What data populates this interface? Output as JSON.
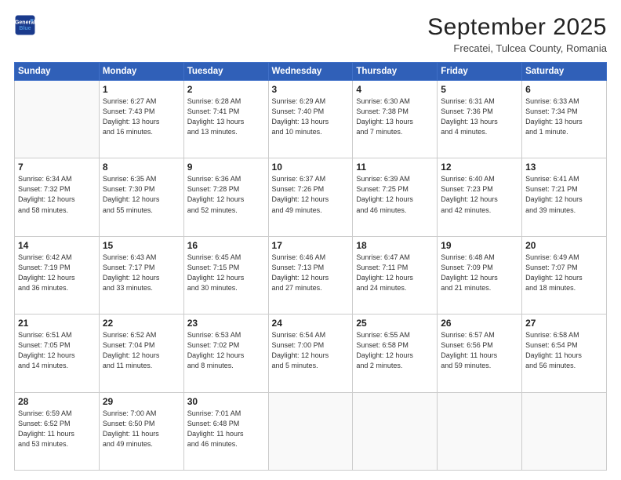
{
  "header": {
    "logo": {
      "line1": "General",
      "line2": "Blue"
    },
    "title": "September 2025",
    "subtitle": "Frecatei, Tulcea County, Romania"
  },
  "days_of_week": [
    "Sunday",
    "Monday",
    "Tuesday",
    "Wednesday",
    "Thursday",
    "Friday",
    "Saturday"
  ],
  "weeks": [
    [
      {
        "day": "",
        "info": ""
      },
      {
        "day": "1",
        "info": "Sunrise: 6:27 AM\nSunset: 7:43 PM\nDaylight: 13 hours\nand 16 minutes."
      },
      {
        "day": "2",
        "info": "Sunrise: 6:28 AM\nSunset: 7:41 PM\nDaylight: 13 hours\nand 13 minutes."
      },
      {
        "day": "3",
        "info": "Sunrise: 6:29 AM\nSunset: 7:40 PM\nDaylight: 13 hours\nand 10 minutes."
      },
      {
        "day": "4",
        "info": "Sunrise: 6:30 AM\nSunset: 7:38 PM\nDaylight: 13 hours\nand 7 minutes."
      },
      {
        "day": "5",
        "info": "Sunrise: 6:31 AM\nSunset: 7:36 PM\nDaylight: 13 hours\nand 4 minutes."
      },
      {
        "day": "6",
        "info": "Sunrise: 6:33 AM\nSunset: 7:34 PM\nDaylight: 13 hours\nand 1 minute."
      }
    ],
    [
      {
        "day": "7",
        "info": "Sunrise: 6:34 AM\nSunset: 7:32 PM\nDaylight: 12 hours\nand 58 minutes."
      },
      {
        "day": "8",
        "info": "Sunrise: 6:35 AM\nSunset: 7:30 PM\nDaylight: 12 hours\nand 55 minutes."
      },
      {
        "day": "9",
        "info": "Sunrise: 6:36 AM\nSunset: 7:28 PM\nDaylight: 12 hours\nand 52 minutes."
      },
      {
        "day": "10",
        "info": "Sunrise: 6:37 AM\nSunset: 7:26 PM\nDaylight: 12 hours\nand 49 minutes."
      },
      {
        "day": "11",
        "info": "Sunrise: 6:39 AM\nSunset: 7:25 PM\nDaylight: 12 hours\nand 46 minutes."
      },
      {
        "day": "12",
        "info": "Sunrise: 6:40 AM\nSunset: 7:23 PM\nDaylight: 12 hours\nand 42 minutes."
      },
      {
        "day": "13",
        "info": "Sunrise: 6:41 AM\nSunset: 7:21 PM\nDaylight: 12 hours\nand 39 minutes."
      }
    ],
    [
      {
        "day": "14",
        "info": "Sunrise: 6:42 AM\nSunset: 7:19 PM\nDaylight: 12 hours\nand 36 minutes."
      },
      {
        "day": "15",
        "info": "Sunrise: 6:43 AM\nSunset: 7:17 PM\nDaylight: 12 hours\nand 33 minutes."
      },
      {
        "day": "16",
        "info": "Sunrise: 6:45 AM\nSunset: 7:15 PM\nDaylight: 12 hours\nand 30 minutes."
      },
      {
        "day": "17",
        "info": "Sunrise: 6:46 AM\nSunset: 7:13 PM\nDaylight: 12 hours\nand 27 minutes."
      },
      {
        "day": "18",
        "info": "Sunrise: 6:47 AM\nSunset: 7:11 PM\nDaylight: 12 hours\nand 24 minutes."
      },
      {
        "day": "19",
        "info": "Sunrise: 6:48 AM\nSunset: 7:09 PM\nDaylight: 12 hours\nand 21 minutes."
      },
      {
        "day": "20",
        "info": "Sunrise: 6:49 AM\nSunset: 7:07 PM\nDaylight: 12 hours\nand 18 minutes."
      }
    ],
    [
      {
        "day": "21",
        "info": "Sunrise: 6:51 AM\nSunset: 7:05 PM\nDaylight: 12 hours\nand 14 minutes."
      },
      {
        "day": "22",
        "info": "Sunrise: 6:52 AM\nSunset: 7:04 PM\nDaylight: 12 hours\nand 11 minutes."
      },
      {
        "day": "23",
        "info": "Sunrise: 6:53 AM\nSunset: 7:02 PM\nDaylight: 12 hours\nand 8 minutes."
      },
      {
        "day": "24",
        "info": "Sunrise: 6:54 AM\nSunset: 7:00 PM\nDaylight: 12 hours\nand 5 minutes."
      },
      {
        "day": "25",
        "info": "Sunrise: 6:55 AM\nSunset: 6:58 PM\nDaylight: 12 hours\nand 2 minutes."
      },
      {
        "day": "26",
        "info": "Sunrise: 6:57 AM\nSunset: 6:56 PM\nDaylight: 11 hours\nand 59 minutes."
      },
      {
        "day": "27",
        "info": "Sunrise: 6:58 AM\nSunset: 6:54 PM\nDaylight: 11 hours\nand 56 minutes."
      }
    ],
    [
      {
        "day": "28",
        "info": "Sunrise: 6:59 AM\nSunset: 6:52 PM\nDaylight: 11 hours\nand 53 minutes."
      },
      {
        "day": "29",
        "info": "Sunrise: 7:00 AM\nSunset: 6:50 PM\nDaylight: 11 hours\nand 49 minutes."
      },
      {
        "day": "30",
        "info": "Sunrise: 7:01 AM\nSunset: 6:48 PM\nDaylight: 11 hours\nand 46 minutes."
      },
      {
        "day": "",
        "info": ""
      },
      {
        "day": "",
        "info": ""
      },
      {
        "day": "",
        "info": ""
      },
      {
        "day": "",
        "info": ""
      }
    ]
  ]
}
